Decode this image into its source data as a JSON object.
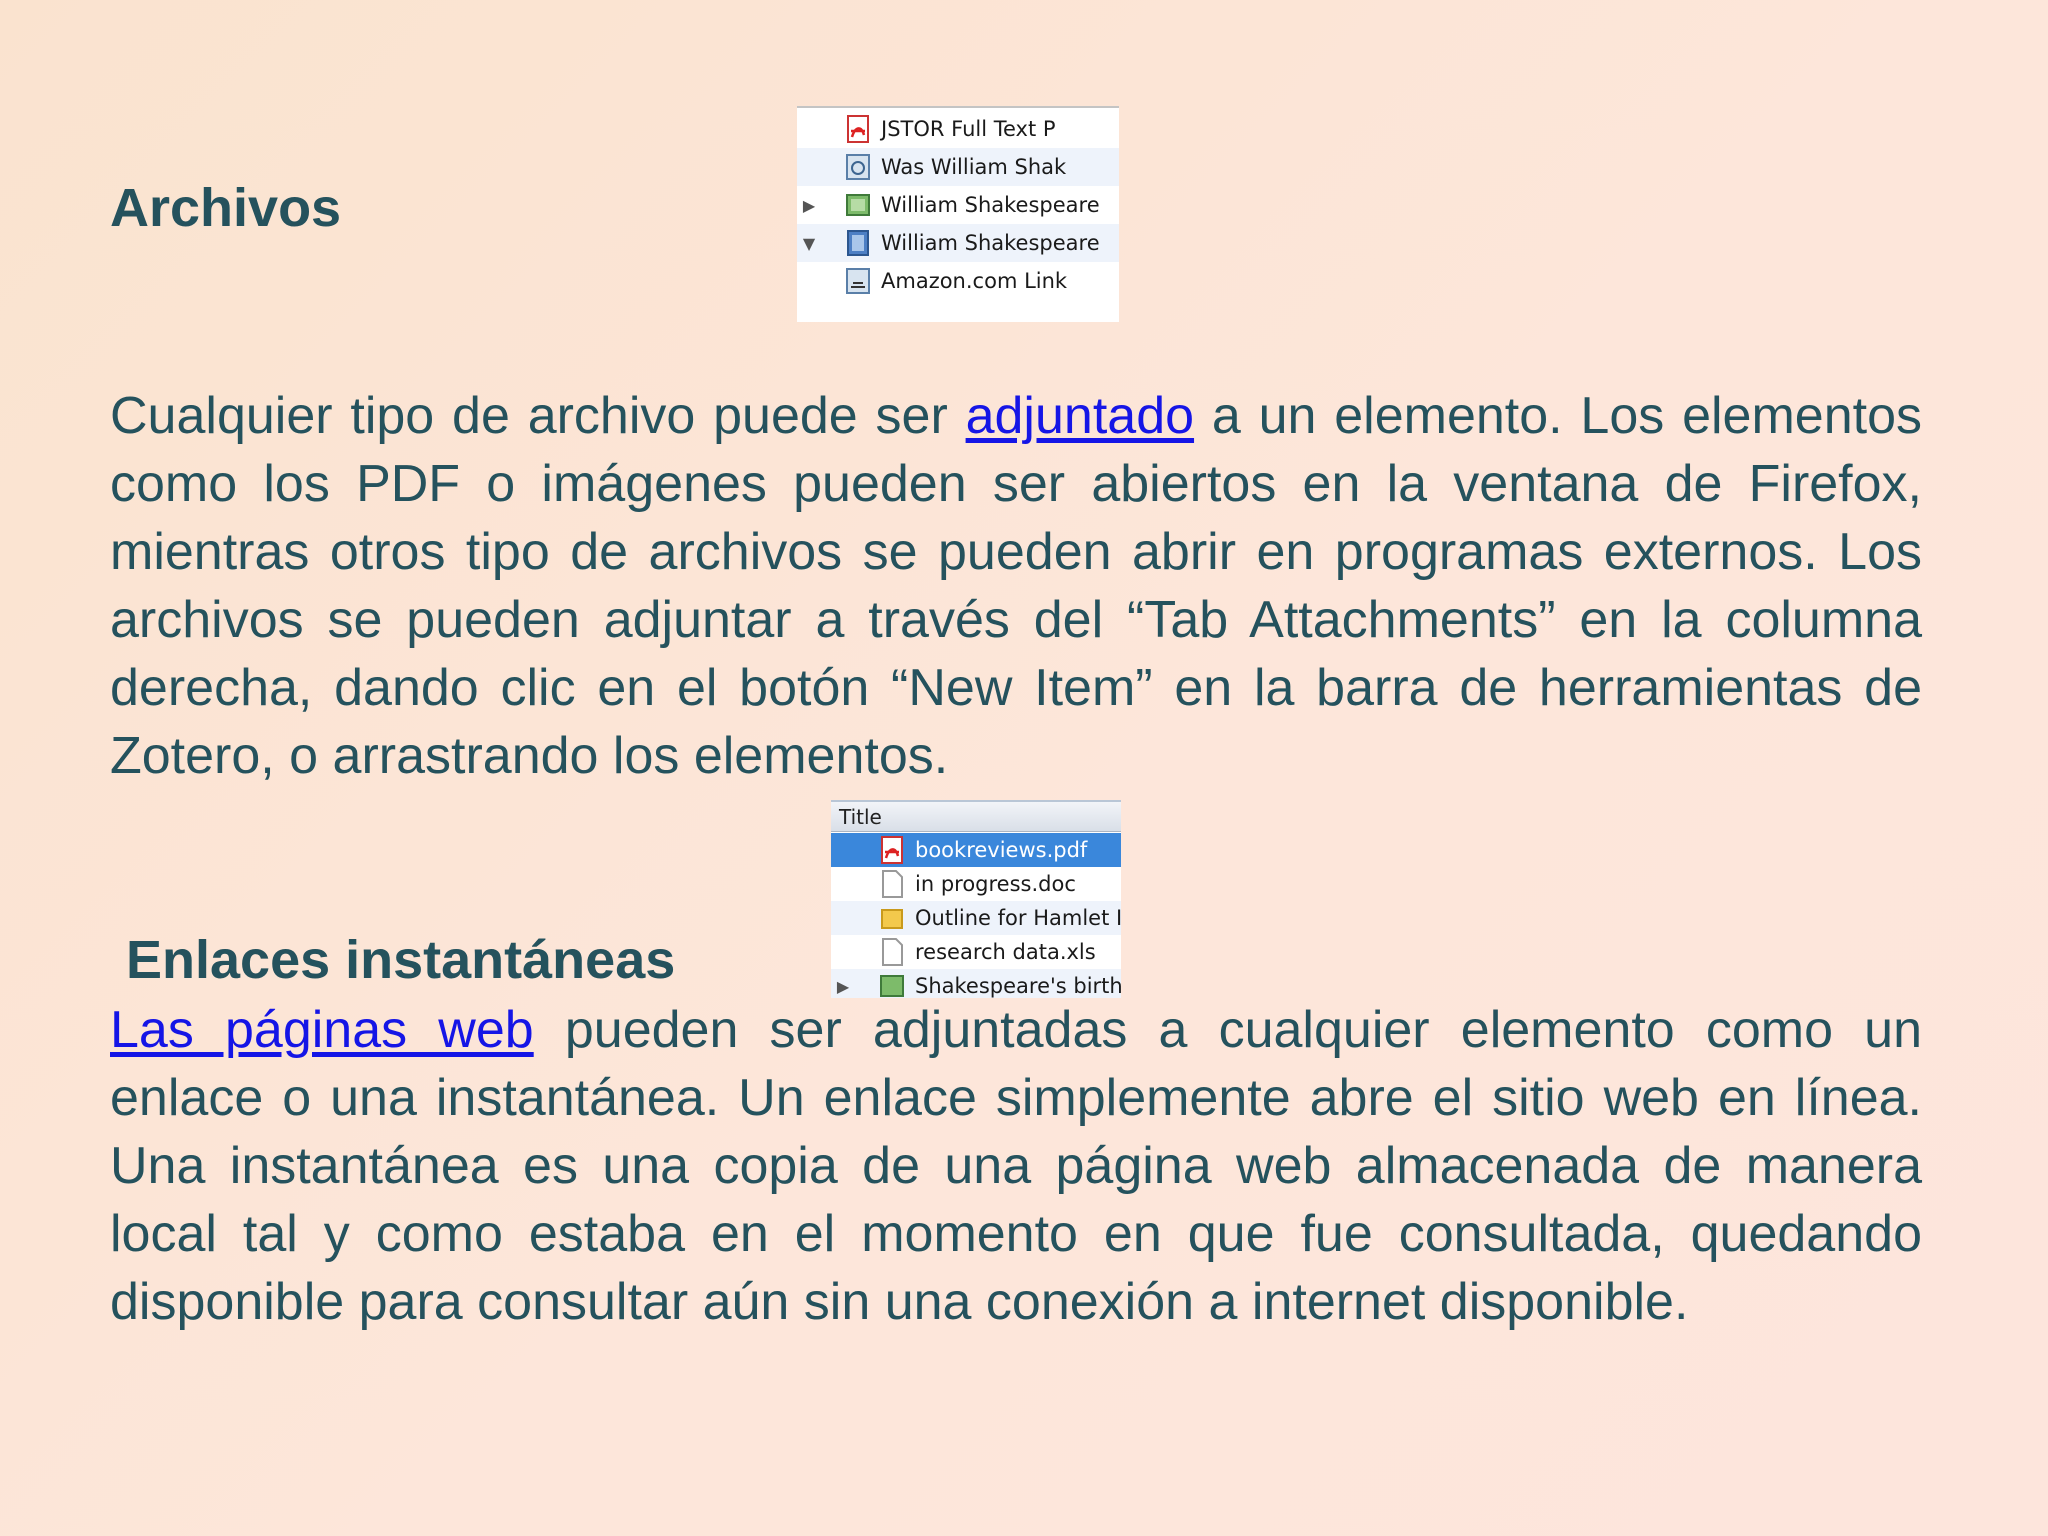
{
  "archivos": {
    "heading": "Archivos",
    "para_before": "Cualquier tipo de archivo puede ser ",
    "link": "adjuntado",
    "para_after": " a un elemento. Los elementos como los PDF o imágenes pueden ser abiertos en la ventana de Firefox, mientras otros tipo de archivos se pueden abrir en programas externos. Los archivos se pueden adjuntar a través del “Tab Attachments” en la columna derecha, dando clic en el botón “New Item” en la barra de herramientas de Zotero, o arrastrando los elementos.",
    "items_panel": [
      {
        "label": "JSTOR Full Text P",
        "icon": "pdf-icon",
        "toggle": ""
      },
      {
        "label": "Was William Shak",
        "icon": "web-snapshot-icon",
        "toggle": ""
      },
      {
        "label": "William Shakespeare",
        "icon": "image-item-icon",
        "toggle": "collapsed"
      },
      {
        "label": "William Shakespeare",
        "icon": "book-icon",
        "toggle": "expanded"
      },
      {
        "label": "Amazon.com Link",
        "icon": "web-link-icon",
        "toggle": ""
      }
    ]
  },
  "enlaces": {
    "heading": "Enlaces instantáneas",
    "link": "Las páginas web",
    "para_after": " pueden ser adjuntadas a cualquier elemento como un enlace o una instantánea. Un enlace simplemente abre el sitio web en línea. Una instantánea es una copia de una página web almacenada de manera local tal y como estaba en el momento en que fue consultada, quedando disponible para consultar aún sin una conexión a internet disponible.",
    "files_panel": {
      "column_title": "Title",
      "rows": [
        {
          "label": "bookreviews.pdf",
          "icon": "pdf-icon",
          "selected": true
        },
        {
          "label": "in progress.doc",
          "icon": "document-icon",
          "selected": false
        },
        {
          "label": "Outline for Hamlet I",
          "icon": "folder-note-icon",
          "selected": false
        },
        {
          "label": "research data.xls",
          "icon": "document-icon",
          "selected": false
        },
        {
          "label": "Shakespeare's birth",
          "icon": "image-item-icon",
          "selected": false
        }
      ]
    }
  },
  "colors": {
    "background": "#fbe4d5",
    "text": "#25525d",
    "link": "#1515e6",
    "selection": "#3a87db"
  }
}
